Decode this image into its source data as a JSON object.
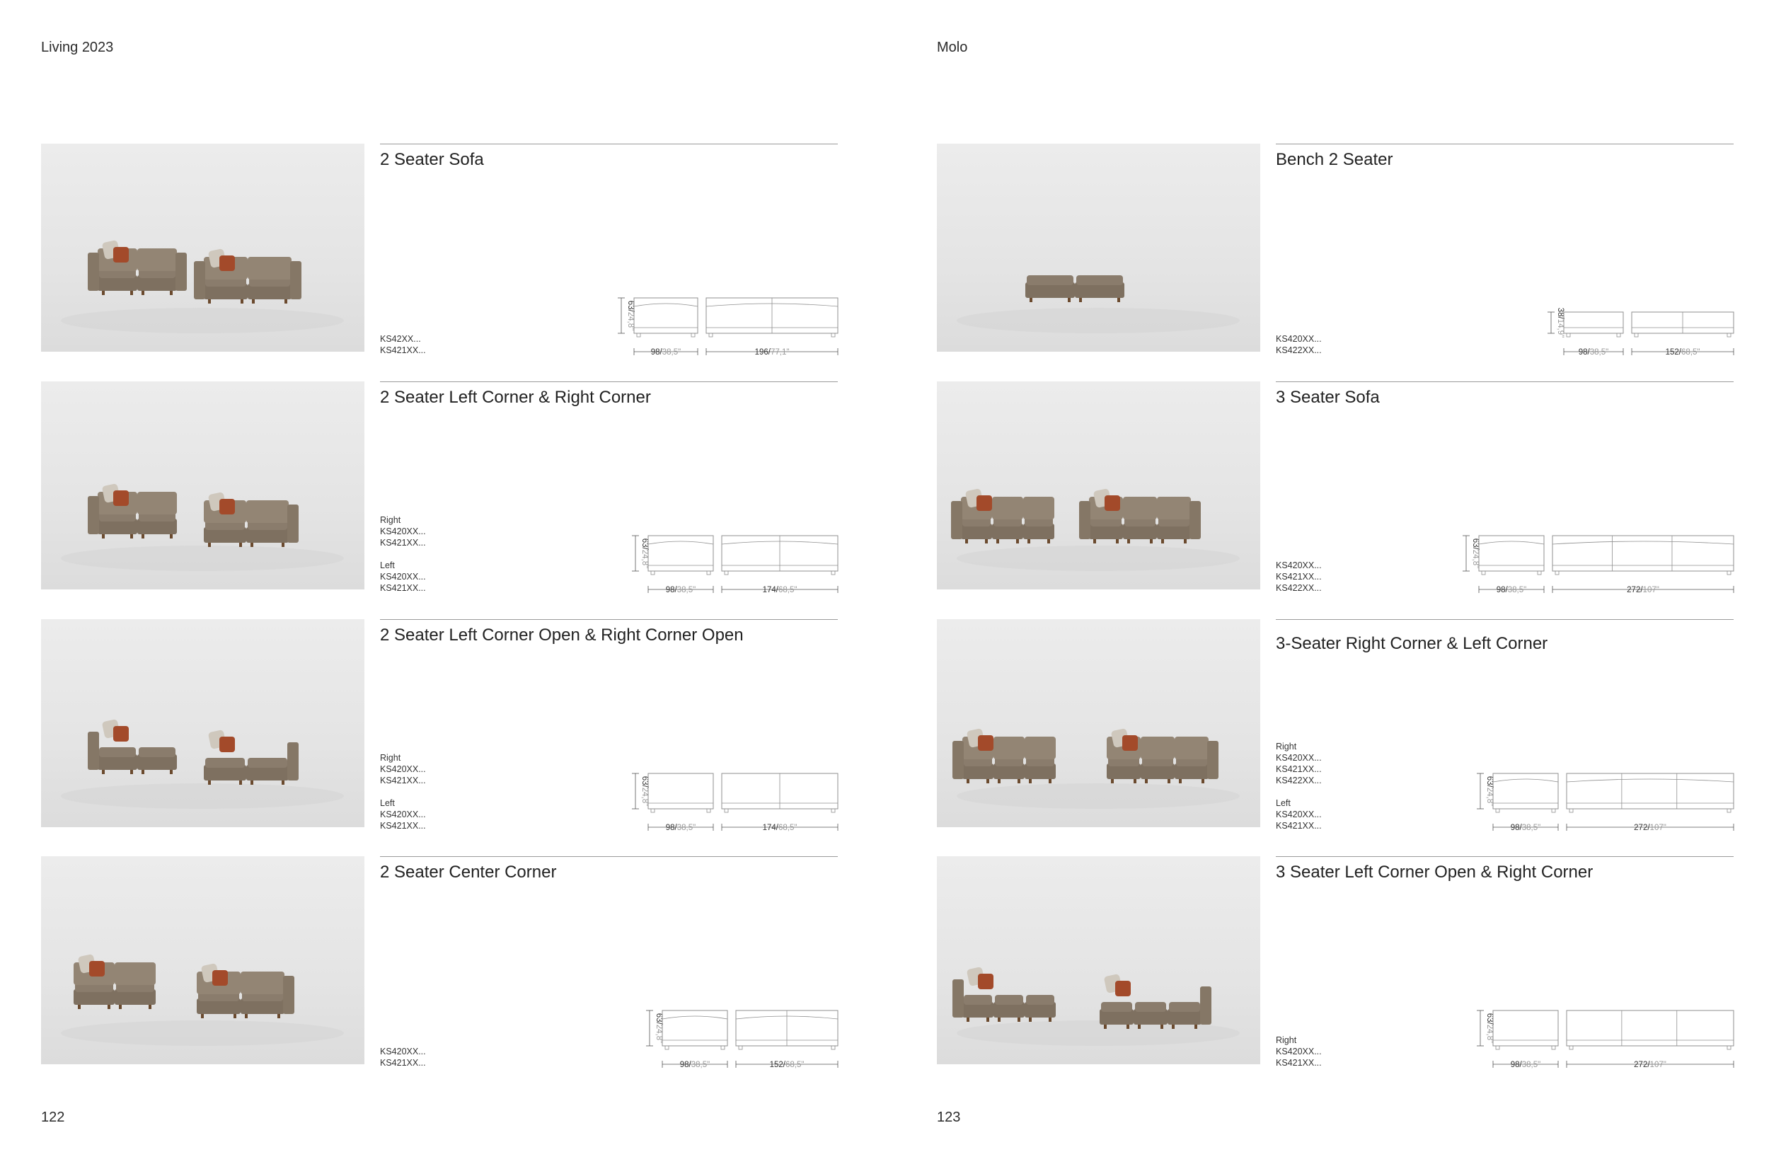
{
  "left_page": {
    "header": "Living 2023",
    "page_number": "122",
    "products": [
      {
        "title": "2 Seater Sofa",
        "groups": [
          {
            "label": "",
            "codes": [
              "KS42XX...",
              "KS421XX..."
            ]
          }
        ],
        "dims": {
          "height_cm": "63",
          "height_in": "24,8\"",
          "depth_cm": "98",
          "depth_in": "38,5\"",
          "width_cm": "196",
          "width_in": "77,1\""
        }
      },
      {
        "title": "2 Seater Left Corner & Right Corner",
        "groups": [
          {
            "label": "Right",
            "codes": [
              "KS420XX...",
              "KS421XX..."
            ]
          },
          {
            "label": "Left",
            "codes": [
              "KS420XX...",
              "KS421XX..."
            ]
          }
        ],
        "dims": {
          "height_cm": "63",
          "height_in": "24,8\"",
          "depth_cm": "98",
          "depth_in": "38,5\"",
          "width_cm": "174",
          "width_in": "68,5\""
        }
      },
      {
        "title": " 2 Seater Left Corner Open & Right Corner Open",
        "groups": [
          {
            "label": "Right",
            "codes": [
              "KS420XX...",
              "KS421XX..."
            ]
          },
          {
            "label": "Left",
            "codes": [
              "KS420XX...",
              "KS421XX..."
            ]
          }
        ],
        "dims": {
          "height_cm": "63",
          "height_in": "24,8\"",
          "depth_cm": "98",
          "depth_in": "38,5\"",
          "width_cm": "174",
          "width_in": "68,5\""
        }
      },
      {
        "title": "2 Seater Center Corner",
        "groups": [
          {
            "label": "",
            "codes": [
              "KS420XX...",
              "KS421XX..."
            ]
          }
        ],
        "dims": {
          "height_cm": "63",
          "height_in": "24,8\"",
          "depth_cm": "98",
          "depth_in": "38,5\"",
          "width_cm": "152",
          "width_in": "68,5\""
        }
      }
    ]
  },
  "right_page": {
    "header": "Molo",
    "page_number": "123",
    "products": [
      {
        "title": "Bench 2 Seater",
        "groups": [
          {
            "label": "",
            "codes": [
              "KS420XX...",
              "KS422XX..."
            ]
          }
        ],
        "dims": {
          "height_cm": "38",
          "height_in": "14,9\"",
          "depth_cm": "98",
          "depth_in": "38,5\"",
          "width_cm": "152",
          "width_in": "68,5\""
        }
      },
      {
        "title": "3 Seater Sofa",
        "groups": [
          {
            "label": "",
            "codes": [
              "KS420XX...",
              "KS421XX...",
              "KS422XX..."
            ]
          }
        ],
        "dims": {
          "height_cm": "63",
          "height_in": "24,8\"",
          "depth_cm": "98",
          "depth_in": "38,5\"",
          "width_cm": "272",
          "width_in": "107\""
        }
      },
      {
        "title": "3-Seater Right Corner & Left Corner",
        "groups": [
          {
            "label": "Right",
            "codes": [
              "KS420XX...",
              "KS421XX...",
              "KS422XX..."
            ]
          },
          {
            "label": "Left",
            "codes": [
              "KS420XX...",
              "KS421XX..."
            ]
          }
        ],
        "dims": {
          "height_cm": "63",
          "height_in": "24,8\"",
          "depth_cm": "98",
          "depth_in": "38,5\"",
          "width_cm": "272",
          "width_in": "107\""
        }
      },
      {
        "title": " 3 Seater Left Corner Open & Right Corner",
        "groups": [
          {
            "label": "Right",
            "codes": [
              "KS420XX...",
              "KS421XX..."
            ]
          }
        ],
        "dims": {
          "height_cm": "63",
          "height_in": "24,8\"",
          "depth_cm": "98",
          "depth_in": "38,5\"",
          "width_cm": "272",
          "width_in": "107\""
        }
      }
    ]
  },
  "colors": {
    "upholstery": "#8a7c6c",
    "cushion_accent": "#a34a2a",
    "cushion_light": "#cfc8bd",
    "line": "#9a9a9a"
  }
}
